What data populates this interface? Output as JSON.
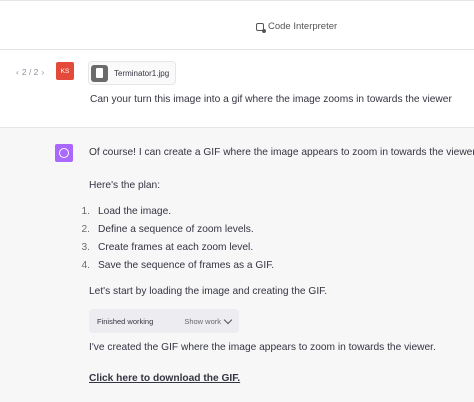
{
  "header": {
    "model_label": "Code Interpreter"
  },
  "user_message": {
    "pager": {
      "prev": "‹",
      "text": "2 / 2",
      "next": "›"
    },
    "avatar_initials": "KS",
    "file_name": "Terminator1.jpg",
    "text": "Can your turn this image into a gif where the image zooms in towards the viewer"
  },
  "assistant_message": {
    "intro": "Of course! I can create a GIF where the image appears to zoom in towards the viewer.",
    "plan_heading": "Here's the plan:",
    "steps": [
      {
        "num": "1.",
        "text": "Load the image."
      },
      {
        "num": "2.",
        "text": "Define a sequence of zoom levels."
      },
      {
        "num": "3.",
        "text": "Create frames at each zoom level."
      },
      {
        "num": "4.",
        "text": "Save the sequence of frames as a GIF."
      }
    ],
    "start_text": "Let's start by loading the image and creating the GIF.",
    "work_status": "Finished working",
    "show_work": "Show work",
    "result_text": "I've created the GIF where the image appears to zoom in towards the viewer.",
    "download_link": "Click here to download the GIF."
  }
}
